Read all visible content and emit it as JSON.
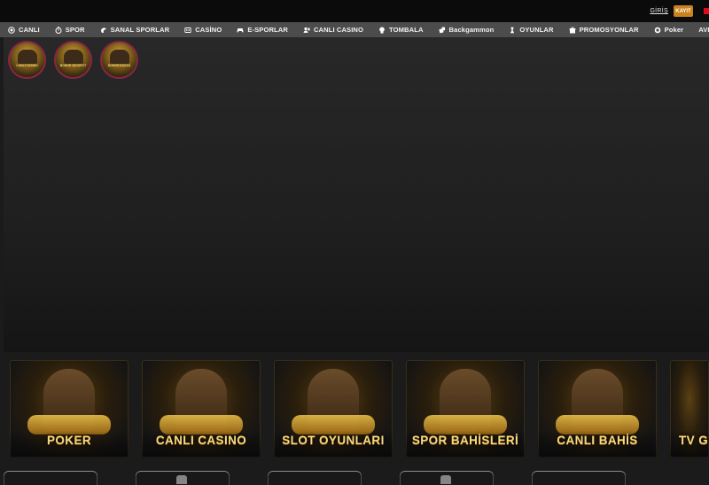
{
  "header": {
    "login_label": "GİRİŞ",
    "register_label": "KAYIT",
    "flag_color": "#e30a17",
    "accent_color": "#c9821c"
  },
  "nav": {
    "items": [
      {
        "label": "CANLI",
        "icon": "live-icon"
      },
      {
        "label": "SPOR",
        "icon": "stopwatch-icon"
      },
      {
        "label": "SANAL SPORLAR",
        "icon": "virtual-sports-icon"
      },
      {
        "label": "CASİNO",
        "icon": "slot-machine-icon"
      },
      {
        "label": "E-SPORLAR",
        "icon": "gamepad-icon"
      },
      {
        "label": "CANLI CASINO",
        "icon": "dealer-icon"
      },
      {
        "label": "TOMBALA",
        "icon": "lottery-icon"
      },
      {
        "label": "Backgammon",
        "icon": "dice-icon"
      },
      {
        "label": "OYUNLAR",
        "icon": "chess-piece-icon"
      },
      {
        "label": "PROMOSYONLAR",
        "icon": "gift-icon"
      },
      {
        "label": "Poker",
        "icon": "poker-chip-icon"
      },
      {
        "label": "AVI",
        "icon": ""
      }
    ]
  },
  "stories": {
    "items": [
      {
        "caption": "CANLI CASINO"
      },
      {
        "caption": "BONUS JACKPOT"
      },
      {
        "caption": "BONUS KAZAN"
      }
    ]
  },
  "categories": {
    "items": [
      {
        "label": "POKER"
      },
      {
        "label": "CANLI CASINO"
      },
      {
        "label": "SLOT OYUNLARI"
      },
      {
        "label": "SPOR BAHİSLERİ"
      },
      {
        "label": "CANLI BAHİS"
      },
      {
        "label": "TV G"
      }
    ]
  }
}
